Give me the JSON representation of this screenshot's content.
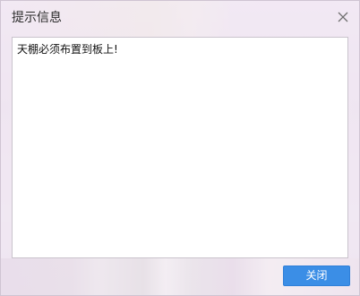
{
  "dialog": {
    "title": "提示信息",
    "message": "天棚必须布置到板上!",
    "close_button_label": "关闭",
    "close_icon": "close-icon",
    "accent_color": "#3b8ee6"
  }
}
